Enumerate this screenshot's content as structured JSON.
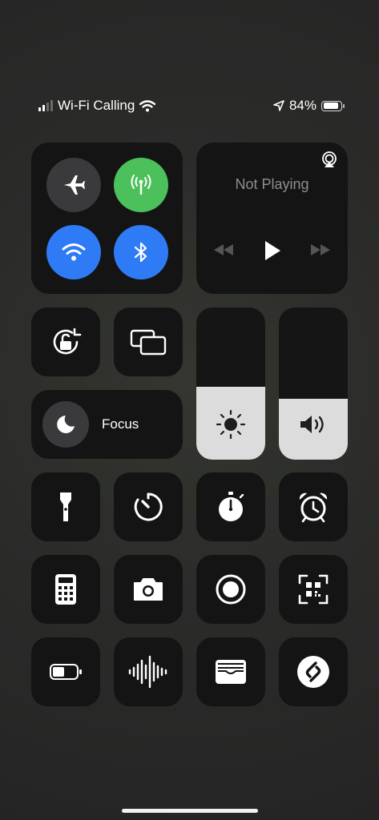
{
  "status": {
    "carrier": "Wi-Fi Calling",
    "battery_text": "84%",
    "battery_level": 0.84,
    "signal_bars": 2
  },
  "connectivity": {
    "airplane": {
      "icon": "airplane-icon",
      "on": false
    },
    "cellular": {
      "icon": "cellular-antenna-icon",
      "on": true,
      "color": "#4cc05a"
    },
    "wifi": {
      "icon": "wifi-icon",
      "on": true,
      "color": "#2f7bf6"
    },
    "bluetooth": {
      "icon": "bluetooth-icon",
      "on": true,
      "color": "#2f7bf6"
    }
  },
  "now_playing": {
    "title": "Not Playing"
  },
  "focus": {
    "label": "Focus"
  },
  "brightness": {
    "level": 0.48
  },
  "volume": {
    "level": 0.4
  },
  "controls_row1": [
    "flashlight-icon",
    "timer-icon",
    "stopwatch-icon",
    "alarm-icon"
  ],
  "controls_row2": [
    "calculator-icon",
    "camera-icon",
    "screen-record-icon",
    "qr-code-scanner-icon"
  ],
  "controls_row3": [
    "low-power-mode-icon",
    "voice-memos-icon",
    "wallet-icon",
    "shazam-icon"
  ]
}
